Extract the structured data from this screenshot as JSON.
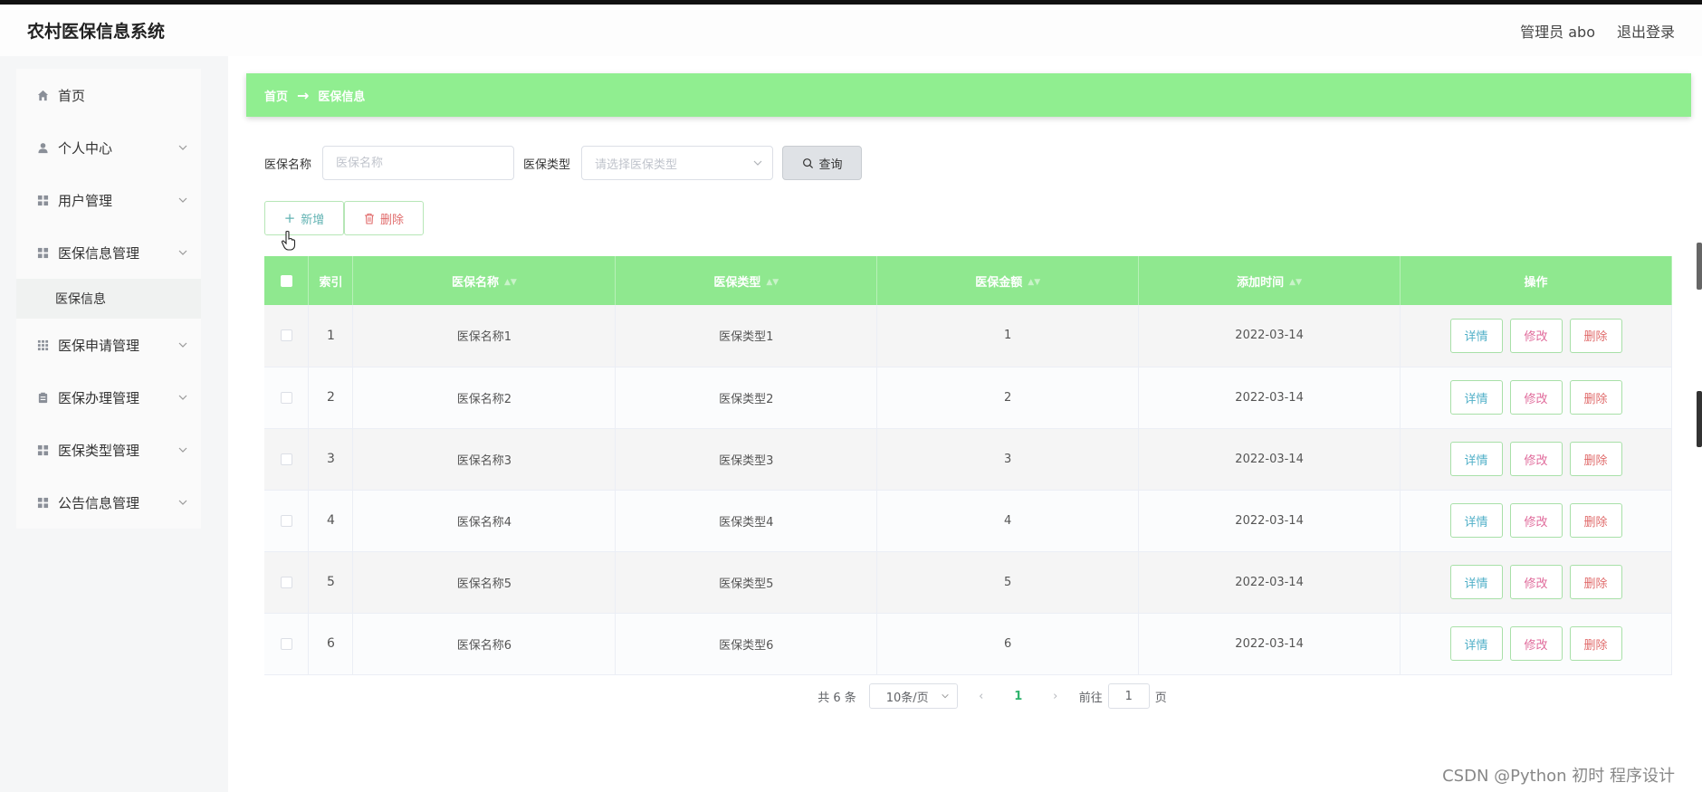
{
  "header": {
    "title": "农村医保信息系统",
    "user": "管理员 abo",
    "logout": "退出登录"
  },
  "sidebar": {
    "items": [
      {
        "label": "首页",
        "icon": "home-icon",
        "expandable": false
      },
      {
        "label": "个人中心",
        "icon": "user-icon",
        "expandable": true
      },
      {
        "label": "用户管理",
        "icon": "grid-icon",
        "expandable": true
      },
      {
        "label": "医保信息管理",
        "icon": "grid-icon",
        "expandable": true,
        "open": true
      },
      {
        "label": "医保申请管理",
        "icon": "grid9-icon",
        "expandable": true
      },
      {
        "label": "医保办理管理",
        "icon": "clipboard-icon",
        "expandable": true
      },
      {
        "label": "医保类型管理",
        "icon": "grid-icon",
        "expandable": true
      },
      {
        "label": "公告信息管理",
        "icon": "grid-icon",
        "expandable": true
      }
    ],
    "submenu_label": "医保信息"
  },
  "breadcrumb": {
    "home": "首页",
    "current": "医保信息"
  },
  "search": {
    "name_label": "医保名称",
    "name_placeholder": "医保名称",
    "type_label": "医保类型",
    "type_placeholder": "请选择医保类型",
    "query_label": "查询"
  },
  "actions": {
    "add": "新增",
    "delete": "删除"
  },
  "table": {
    "columns": [
      "索引",
      "医保名称",
      "医保类型",
      "医保金额",
      "添加时间",
      "操作"
    ],
    "rows": [
      {
        "index": "1",
        "name": "医保名称1",
        "type": "医保类型1",
        "amount": "1",
        "date": "2022-03-14"
      },
      {
        "index": "2",
        "name": "医保名称2",
        "type": "医保类型2",
        "amount": "2",
        "date": "2022-03-14"
      },
      {
        "index": "3",
        "name": "医保名称3",
        "type": "医保类型3",
        "amount": "3",
        "date": "2022-03-14"
      },
      {
        "index": "4",
        "name": "医保名称4",
        "type": "医保类型4",
        "amount": "4",
        "date": "2022-03-14"
      },
      {
        "index": "5",
        "name": "医保名称5",
        "type": "医保类型5",
        "amount": "5",
        "date": "2022-03-14"
      },
      {
        "index": "6",
        "name": "医保名称6",
        "type": "医保类型6",
        "amount": "6",
        "date": "2022-03-14"
      }
    ],
    "row_actions": {
      "detail": "详情",
      "edit": "修改",
      "remove": "删除"
    }
  },
  "pagination": {
    "total": "共 6 条",
    "page_size": "10条/页",
    "current_page": "1",
    "goto_label": "前往",
    "goto_value": "1",
    "page_suffix": "页"
  },
  "watermark": "CSDN @Python 初时 程序设计",
  "colors": {
    "accent": "#90ee90",
    "header_row": "#8fe88f",
    "page_active": "#2fb36d"
  }
}
